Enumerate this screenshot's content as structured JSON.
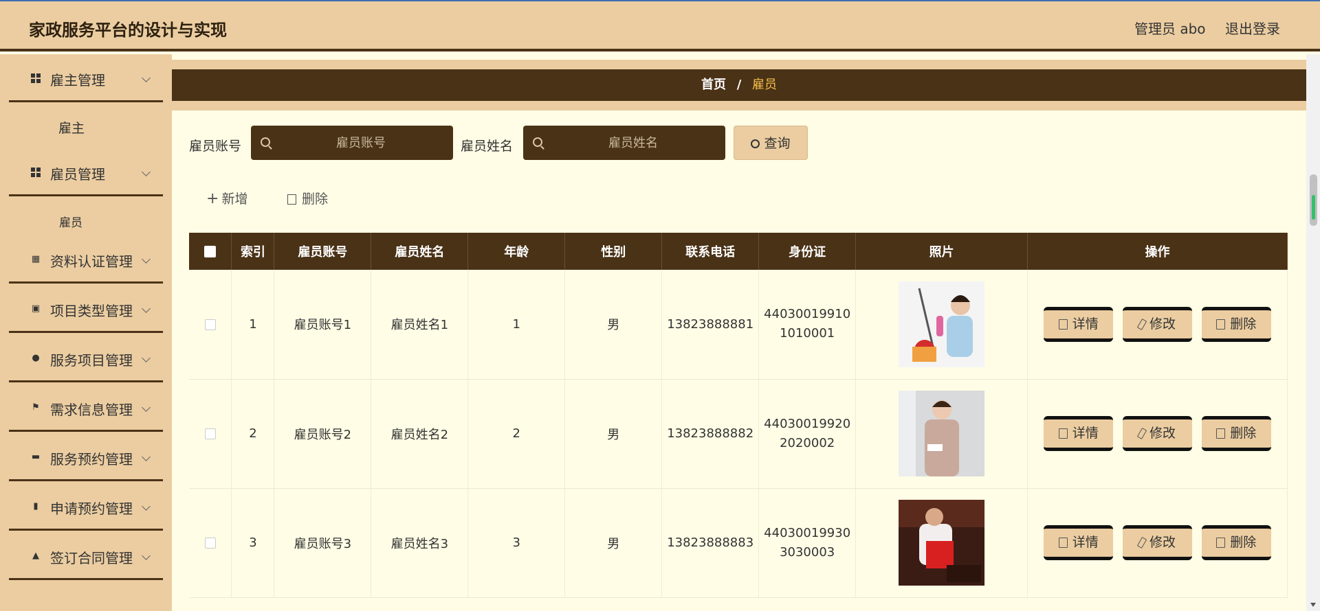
{
  "header": {
    "title": "家政服务平台的设计与实现",
    "user": "管理员 abo",
    "logout": "退出登录"
  },
  "sidebar": {
    "menus": [
      {
        "label": "雇主管理",
        "icon": "grid-icon",
        "sub": "雇主"
      },
      {
        "label": "雇员管理",
        "icon": "grid-icon",
        "sub": "雇员"
      },
      {
        "label": "资料认证管理",
        "icon": "clipboard-icon"
      },
      {
        "label": "项目类型管理",
        "icon": "briefcase-icon"
      },
      {
        "label": "服务项目管理",
        "icon": "person-icon"
      },
      {
        "label": "需求信息管理",
        "icon": "flag-icon"
      },
      {
        "label": "服务预约管理",
        "icon": "wallet-icon"
      },
      {
        "label": "申请预约管理",
        "icon": "bar-chart-icon"
      },
      {
        "label": "签订合同管理",
        "icon": "stamp-icon"
      }
    ]
  },
  "breadcrumb": {
    "home": "首页",
    "sep": "/",
    "current": "雇员"
  },
  "search": {
    "account_label": "雇员账号",
    "account_placeholder": "雇员账号",
    "name_label": "雇员姓名",
    "name_placeholder": "雇员姓名",
    "query": "查询"
  },
  "actions": {
    "add": "新增",
    "delete": "删除"
  },
  "table": {
    "headers": [
      "索引",
      "雇员账号",
      "雇员姓名",
      "年龄",
      "性别",
      "联系电话",
      "身份证",
      "照片",
      "操作"
    ],
    "rows": [
      {
        "index": "1",
        "account": "雇员账号1",
        "name": "雇员姓名1",
        "age": "1",
        "gender": "男",
        "phone": "13823888881",
        "id1": "44030019910",
        "id2": "1010001"
      },
      {
        "index": "2",
        "account": "雇员账号2",
        "name": "雇员姓名2",
        "age": "2",
        "gender": "男",
        "phone": "13823888882",
        "id1": "44030019920",
        "id2": "2020002"
      },
      {
        "index": "3",
        "account": "雇员账号3",
        "name": "雇员姓名3",
        "age": "3",
        "gender": "男",
        "phone": "13823888883",
        "id1": "44030019930",
        "id2": "3030003"
      }
    ],
    "buttons": {
      "detail": "详情",
      "edit": "修改",
      "delete": "删除"
    }
  },
  "colors": {
    "header_bg": "#ebcda1",
    "dark_brown": "#4a3217",
    "content_bg": "#fffde6",
    "breadcrumb_current": "#f5c04a"
  }
}
